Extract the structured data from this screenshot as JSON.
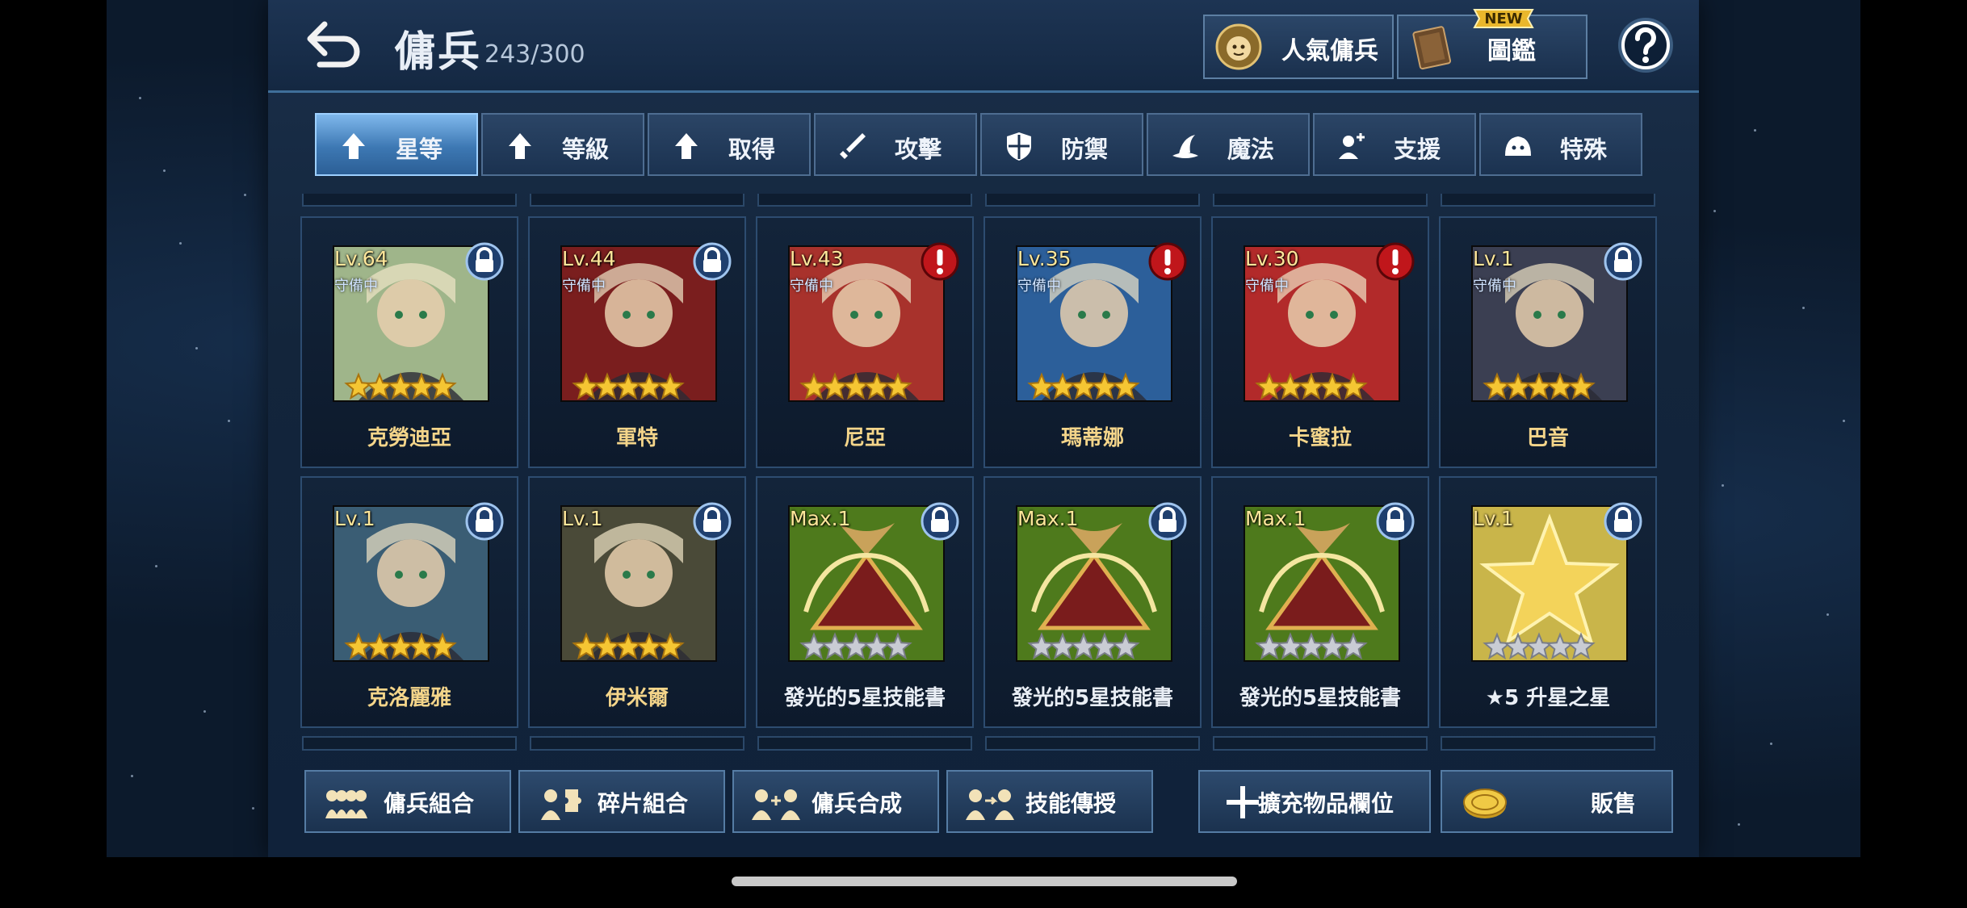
{
  "header": {
    "title": "傭兵",
    "count": "243/300",
    "popular_label": "人氣傭兵",
    "codex_label": "圖鑑",
    "codex_badge": "NEW"
  },
  "tabs": [
    {
      "label": "星等",
      "icon": "arrow-up-icon",
      "active": true
    },
    {
      "label": "等級",
      "icon": "arrow-up-icon",
      "active": false
    },
    {
      "label": "取得",
      "icon": "arrow-up-icon",
      "active": false
    },
    {
      "label": "攻擊",
      "icon": "sword-icon",
      "active": false
    },
    {
      "label": "防禦",
      "icon": "shield-icon",
      "active": false
    },
    {
      "label": "魔法",
      "icon": "witch-hat-icon",
      "active": false
    },
    {
      "label": "支援",
      "icon": "support-icon",
      "active": false
    },
    {
      "label": "特殊",
      "icon": "slime-icon",
      "active": false
    }
  ],
  "cards": [
    {
      "name": "克勞迪亞",
      "level": "Lv.64",
      "status": "守備中",
      "badge": "lock",
      "stars_gold": 5,
      "bg": "#9fb58a"
    },
    {
      "name": "軍特",
      "level": "Lv.44",
      "status": "守備中",
      "badge": "lock",
      "stars_gold": 5,
      "bg": "#7a1e1e"
    },
    {
      "name": "尼亞",
      "level": "Lv.43",
      "status": "守備中",
      "badge": "alert",
      "stars_gold": 5,
      "bg": "#a8322c"
    },
    {
      "name": "瑪蒂娜",
      "level": "Lv.35",
      "status": "守備中",
      "badge": "alert",
      "stars_gold": 5,
      "bg": "#2c5f9a"
    },
    {
      "name": "卡蜜拉",
      "level": "Lv.30",
      "status": "守備中",
      "badge": "alert",
      "stars_gold": 5,
      "bg": "#b22a2a"
    },
    {
      "name": "巴音",
      "level": "Lv.1",
      "status": "守備中",
      "badge": "lock",
      "stars_gold": 5,
      "bg": "#3b3f52"
    },
    {
      "name": "克洛麗雅",
      "level": "Lv.1",
      "status": "",
      "badge": "lock",
      "stars_gold": 5,
      "bg": "#3a5d74"
    },
    {
      "name": "伊米爾",
      "level": "Lv.1",
      "status": "",
      "badge": "lock",
      "stars_gold": 5,
      "bg": "#4a4a38"
    },
    {
      "name": "發光的5星技能書",
      "level": "Max.1",
      "status": "",
      "badge": "lock",
      "stars_gold": 0,
      "bg": "#4e7a1c"
    },
    {
      "name": "發光的5星技能書",
      "level": "Max.1",
      "status": "",
      "badge": "lock",
      "stars_gold": 0,
      "bg": "#4e7a1c"
    },
    {
      "name": "發光的5星技能書",
      "level": "Max.1",
      "status": "",
      "badge": "lock",
      "stars_gold": 0,
      "bg": "#4e7a1c"
    },
    {
      "name": "★5 升星之星",
      "level": "Lv.1",
      "status": "",
      "badge": "lock",
      "stars_gold": 0,
      "bg": "#c9b54a"
    }
  ],
  "bottom_buttons": [
    {
      "label": "傭兵組合",
      "icon": "mercenary-group-icon"
    },
    {
      "label": "碎片組合",
      "icon": "puzzle-pieces-icon"
    },
    {
      "label": "傭兵合成",
      "icon": "mercenary-fusion-icon"
    },
    {
      "label": "技能傳授",
      "icon": "skill-transfer-icon"
    },
    {
      "label": "擴充物品欄位",
      "icon": "plus-icon"
    },
    {
      "label": "販售",
      "icon": "gold-coin-icon"
    }
  ],
  "colors": {
    "accent_blue": "#3d78b3",
    "name_gold": "#f4d58a",
    "level_yellow": "#ffe79a",
    "alert_red": "#c0161b"
  }
}
